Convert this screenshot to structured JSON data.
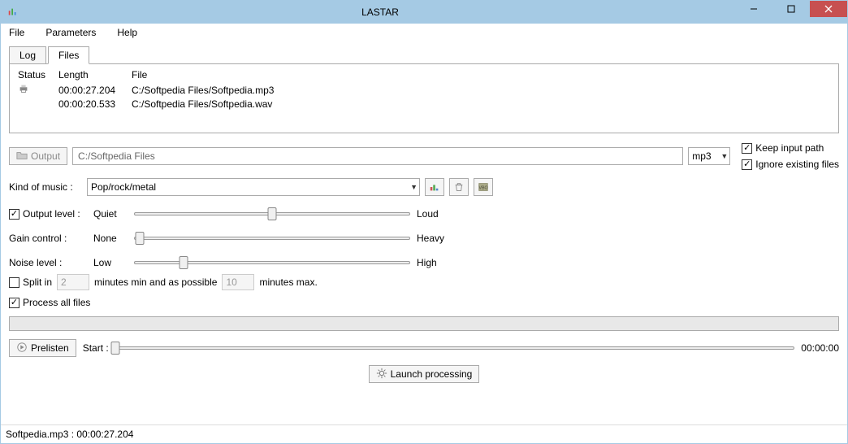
{
  "window": {
    "title": "LASTAR"
  },
  "menu": {
    "items": [
      "File",
      "Parameters",
      "Help"
    ]
  },
  "tabs": {
    "items": [
      "Log",
      "Files"
    ],
    "active": 1
  },
  "file_table": {
    "headers": [
      "Status",
      "Length",
      "File"
    ],
    "rows": [
      {
        "status_icon": "printer-icon",
        "length": "00:00:27.204",
        "file": "C:/Softpedia Files/Softpedia.mp3"
      },
      {
        "status_icon": "",
        "length": "00:00:20.533",
        "file": "C:/Softpedia Files/Softpedia.wav"
      }
    ]
  },
  "output": {
    "button_label": "Output",
    "path": "C:/Softpedia Files",
    "format": "mp3",
    "keep_input_path_label": "Keep input path",
    "keep_input_path_checked": true,
    "ignore_existing_label": "Ignore existing files",
    "ignore_existing_checked": true
  },
  "kind_of_music": {
    "label": "Kind of music :",
    "value": "Pop/rock/metal"
  },
  "sliders": {
    "output_level": {
      "label": "Output level :",
      "checked": true,
      "left": "Quiet",
      "right": "Loud",
      "pos": 50
    },
    "gain_control": {
      "label": "Gain control :",
      "left": "None",
      "right": "Heavy",
      "pos": 2
    },
    "noise_level": {
      "label": "Noise level :",
      "left": "Low",
      "right": "High",
      "pos": 18
    }
  },
  "split": {
    "label": "Split in",
    "checked": false,
    "min_value": "2",
    "mid_text": "minutes min and as possible",
    "max_value": "10",
    "suffix": "minutes max."
  },
  "process_all": {
    "label": "Process all files",
    "checked": true
  },
  "prelisten": {
    "button_label": "Prelisten",
    "start_label": "Start :",
    "time": "00:00:00"
  },
  "launch": {
    "label": "Launch processing"
  },
  "statusbar": "Softpedia.mp3 : 00:00:27.204"
}
